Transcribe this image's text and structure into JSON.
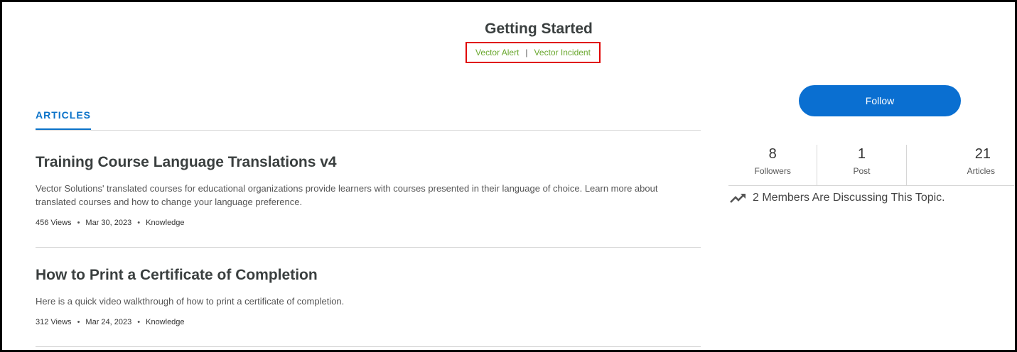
{
  "header": {
    "title": "Getting Started",
    "breadcrumbs": [
      {
        "label": "Vector Alert"
      },
      {
        "label": "Vector Incident"
      }
    ],
    "separator": "|"
  },
  "tabs": [
    {
      "label": "ARTICLES",
      "active": true
    }
  ],
  "articles": [
    {
      "title": "Training Course Language Translations v4",
      "summary": "Vector Solutions' translated courses for educational organizations provide learners with courses presented in their language of choice. Learn more about translated courses and how to change your language preference.",
      "views": "456 Views",
      "date": "Mar 30, 2023",
      "category": "Knowledge"
    },
    {
      "title": "How to Print a Certificate of Completion",
      "summary": "Here is a quick video walkthrough of how to print a certificate of completion.",
      "views": "312 Views",
      "date": "Mar 24, 2023",
      "category": "Knowledge"
    }
  ],
  "sidebar": {
    "follow_label": "Follow",
    "stats": [
      {
        "value": "8",
        "label": "Followers"
      },
      {
        "value": "1",
        "label": "Post"
      },
      {
        "value": "21",
        "label": "Articles"
      }
    ],
    "discussion": "2 Members Are Discussing This Topic.",
    "discussion_icon": "trending-up-icon"
  },
  "colors": {
    "accent_blue": "#0a72c9",
    "link_green": "#6aa82f",
    "highlight_red": "#e00000"
  }
}
